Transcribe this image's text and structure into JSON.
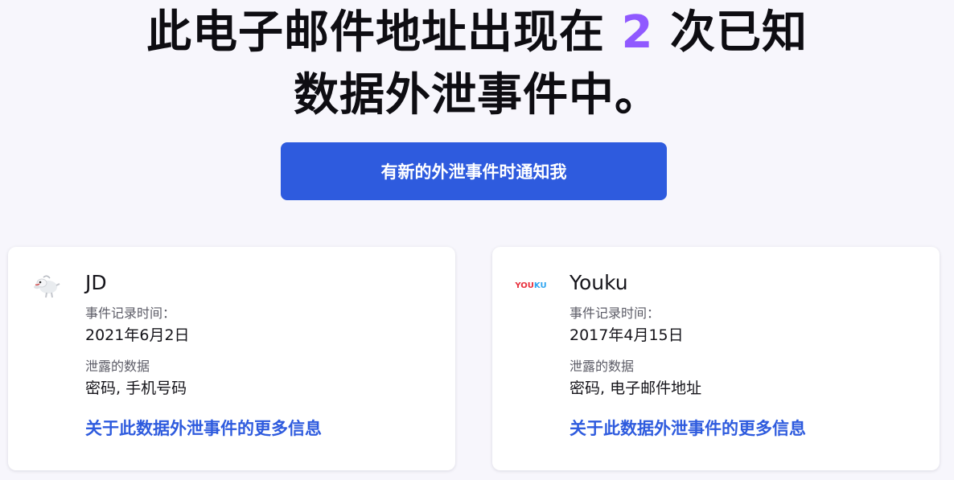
{
  "headline": {
    "line1_prefix": "此电子邮件地址出现在",
    "count": "2",
    "line1_suffix": "次已知",
    "line2": "数据外泄事件中。"
  },
  "notify_button": {
    "label": "有新的外泄事件时通知我"
  },
  "breaches": [
    {
      "company": "JD",
      "logo_icon": "jd-mascot-dog-icon",
      "date_label": "事件记录时间：",
      "date": "2021年6月2日",
      "data_label": "泄露的数据",
      "data": "密码, 手机号码",
      "link_label": "关于此数据外泄事件的更多信息"
    },
    {
      "company": "Youku",
      "logo_icon": "youku-logo-icon",
      "logo_text_1": "YOU",
      "logo_text_2": "KU",
      "date_label": "事件记录时间：",
      "date": "2017年4月15日",
      "data_label": "泄露的数据",
      "data": "密码, 电子邮件地址",
      "link_label": "关于此数据外泄事件的更多信息"
    }
  ],
  "colors": {
    "background": "#f7f6fc",
    "accent_purple": "#9059ff",
    "button_blue": "#2e5bde",
    "link_blue": "#2e5bde",
    "youku_red": "#e8313d",
    "youku_blue": "#2fa5f0"
  }
}
